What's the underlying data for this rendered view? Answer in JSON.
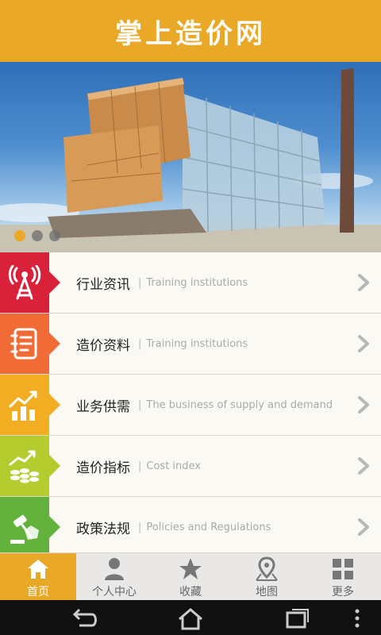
{
  "header": {
    "title": "掌上造价网"
  },
  "banner": {
    "image_description_icon": "building-photo",
    "dots": [
      true,
      false,
      false
    ]
  },
  "menu": {
    "items": [
      {
        "title": "行业资讯",
        "subtitle": "Training institutions",
        "icon": "broadcast-tower-icon",
        "color": "#d9223a"
      },
      {
        "title": "造价资料",
        "subtitle": "Training institutions",
        "icon": "notebook-icon",
        "color": "#f06b35"
      },
      {
        "title": "业务供需",
        "subtitle": "The business of supply and demand",
        "icon": "growth-chart-icon",
        "color": "#f3ad22"
      },
      {
        "title": "造价指标",
        "subtitle": "Cost index",
        "icon": "coins-trend-icon",
        "color": "#b5cc2f"
      },
      {
        "title": "政策法规",
        "subtitle": "Policies and Regulations",
        "icon": "gavel-icon",
        "color": "#62b23c"
      }
    ],
    "separator": "|"
  },
  "tabbar": {
    "tabs": [
      {
        "label": "首页",
        "icon": "home-icon",
        "active": true
      },
      {
        "label": "个人中心",
        "icon": "person-icon",
        "active": false
      },
      {
        "label": "收藏",
        "icon": "star-icon",
        "active": false
      },
      {
        "label": "地图",
        "icon": "map-pin-icon",
        "active": false
      },
      {
        "label": "更多",
        "icon": "grid-icon",
        "active": false
      }
    ]
  },
  "colors": {
    "accent": "#e9a825",
    "tab_inactive": "#777777"
  }
}
